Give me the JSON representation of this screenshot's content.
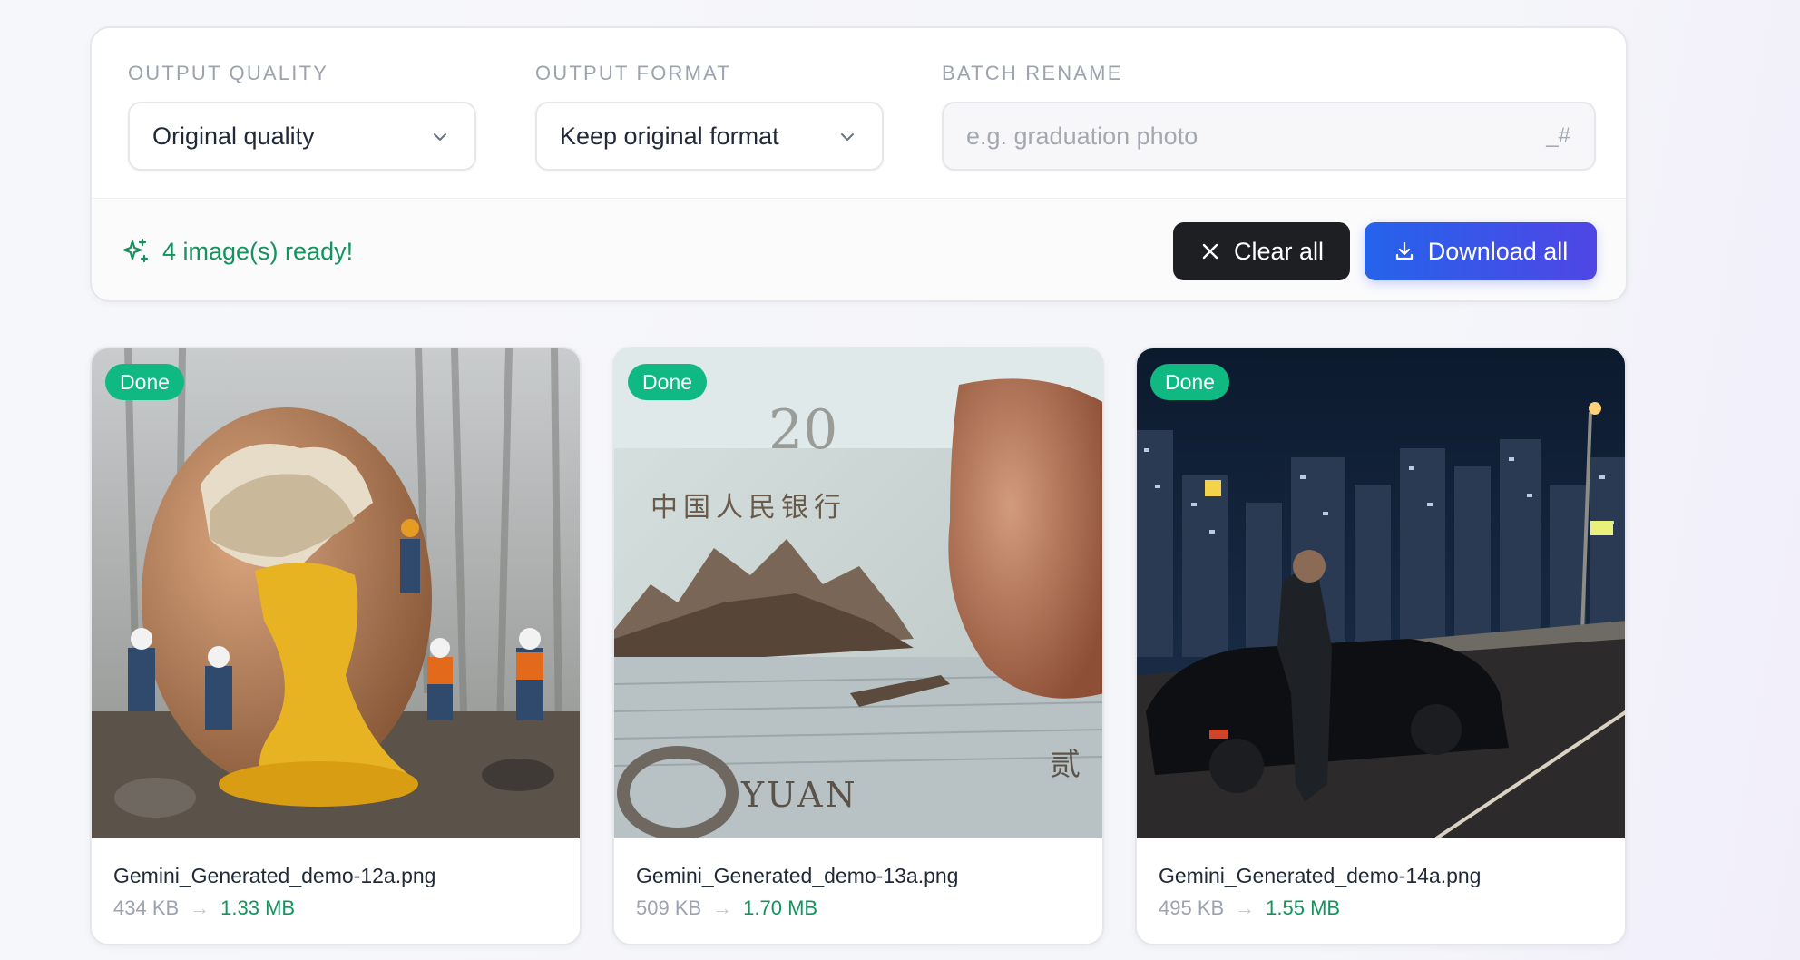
{
  "settings": {
    "quality_label": "OUTPUT QUALITY",
    "quality_value": "Original quality",
    "format_label": "OUTPUT FORMAT",
    "format_value": "Keep original format",
    "rename_label": "BATCH RENAME",
    "rename_placeholder": "e.g. graduation photo",
    "rename_value": "",
    "rename_suffix": "_#"
  },
  "status": {
    "ready_text": "4 image(s) ready!",
    "clear_label": "Clear all",
    "download_label": "Download all"
  },
  "images": [
    {
      "status": "Done",
      "filename": "Gemini_Generated_demo-12a.png",
      "original_size": "434 KB",
      "new_size": "1.33 MB",
      "thumb_icon": "giant-egg-with-workers-photo"
    },
    {
      "status": "Done",
      "filename": "Gemini_Generated_demo-13a.png",
      "original_size": "509 KB",
      "new_size": "1.70 MB",
      "thumb_icon": "yuan-banknote-closeup-photo"
    },
    {
      "status": "Done",
      "filename": "Gemini_Generated_demo-14a.png",
      "original_size": "495 KB",
      "new_size": "1.55 MB",
      "thumb_icon": "man-with-car-city-night-photo"
    }
  ],
  "colors": {
    "success": "#10b981",
    "success_text": "#15935e",
    "primary_start": "#2563eb",
    "primary_end": "#4f46e5",
    "dark_button": "#1e1f23"
  }
}
